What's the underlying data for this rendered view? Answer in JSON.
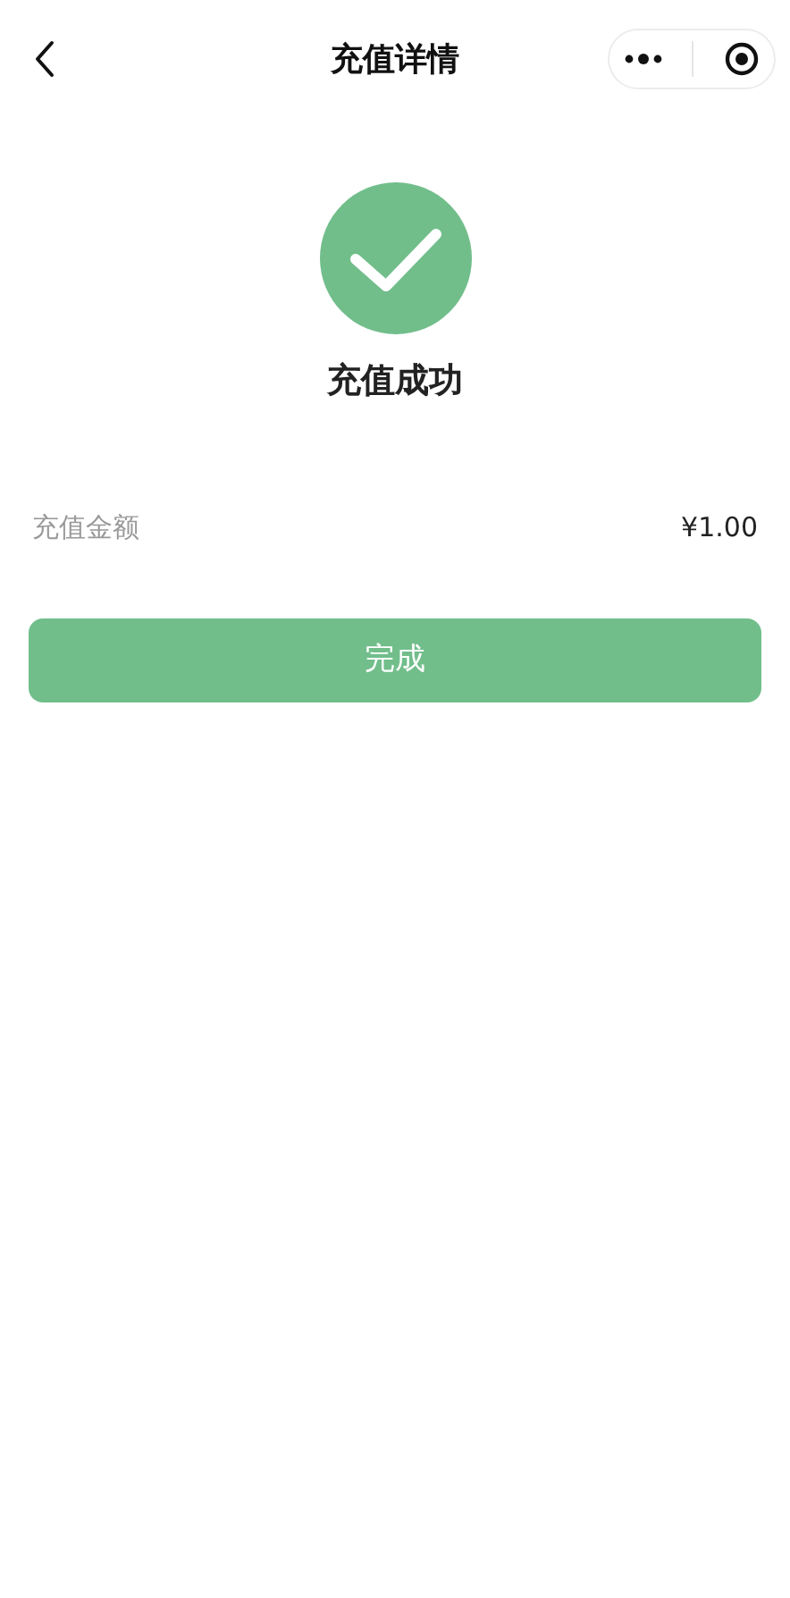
{
  "nav": {
    "title": "充值详情"
  },
  "result": {
    "title": "充值成功"
  },
  "amount": {
    "label": "充值金额",
    "value": "¥1.00"
  },
  "button": {
    "label": "完成"
  }
}
